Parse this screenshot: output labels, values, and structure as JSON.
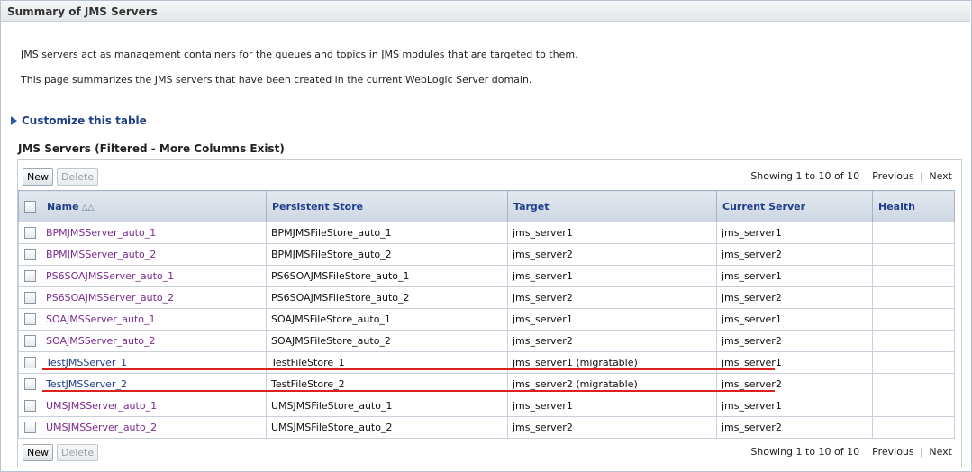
{
  "header": {
    "title": "Summary of JMS Servers"
  },
  "description": {
    "line1": "JMS servers act as management containers for the queues and topics in JMS modules that are targeted to them.",
    "line2": "This page summarizes the JMS servers that have been created in the current WebLogic Server domain."
  },
  "customize_label": "Customize this table",
  "table_title": "JMS Servers (Filtered - More Columns Exist)",
  "toolbar": {
    "new_label": "New",
    "delete_label": "Delete",
    "showing": "Showing 1 to 10 of 10",
    "previous": "Previous",
    "separator": "|",
    "next": "Next"
  },
  "columns": [
    "Name",
    "Persistent Store",
    "Target",
    "Current Server",
    "Health"
  ],
  "rows": [
    {
      "name": "BPMJMSServer_auto_1",
      "store": "BPMJMSFileStore_auto_1",
      "target": "jms_server1",
      "current": "jms_server1",
      "health": ""
    },
    {
      "name": "BPMJMSServer_auto_2",
      "store": "BPMJMSFileStore_auto_2",
      "target": "jms_server2",
      "current": "jms_server2",
      "health": ""
    },
    {
      "name": "PS6SOAJMSServer_auto_1",
      "store": "PS6SOAJMSFileStore_auto_1",
      "target": "jms_server1",
      "current": "jms_server1",
      "health": ""
    },
    {
      "name": "PS6SOAJMSServer_auto_2",
      "store": "PS6SOAJMSFileStore_auto_2",
      "target": "jms_server2",
      "current": "jms_server2",
      "health": ""
    },
    {
      "name": "SOAJMSServer_auto_1",
      "store": "SOAJMSFileStore_auto_1",
      "target": "jms_server1",
      "current": "jms_server1",
      "health": ""
    },
    {
      "name": "SOAJMSServer_auto_2",
      "store": "SOAJMSFileStore_auto_2",
      "target": "jms_server2",
      "current": "jms_server2",
      "health": ""
    },
    {
      "name": "TestJMSServer_1",
      "store": "TestFileStore_1",
      "target": "jms_server1 (migratable)",
      "current": "jms_server1",
      "health": ""
    },
    {
      "name": "TestJMSServer_2",
      "store": "TestFileStore_2",
      "target": "jms_server2 (migratable)",
      "current": "jms_server2",
      "health": ""
    },
    {
      "name": "UMSJMSServer_auto_1",
      "store": "UMSJMSFileStore_auto_1",
      "target": "jms_server1",
      "current": "jms_server1",
      "health": ""
    },
    {
      "name": "UMSJMSServer_auto_2",
      "store": "UMSJMSFileStore_auto_2",
      "target": "jms_server2",
      "current": "jms_server2",
      "health": ""
    }
  ],
  "highlighted_rows": [
    "TestJMSServer_1",
    "TestJMSServer_2"
  ],
  "colors": {
    "link_visited": "#7b2a8f",
    "link": "#1f3f8a",
    "highlight": "#d9231c"
  }
}
